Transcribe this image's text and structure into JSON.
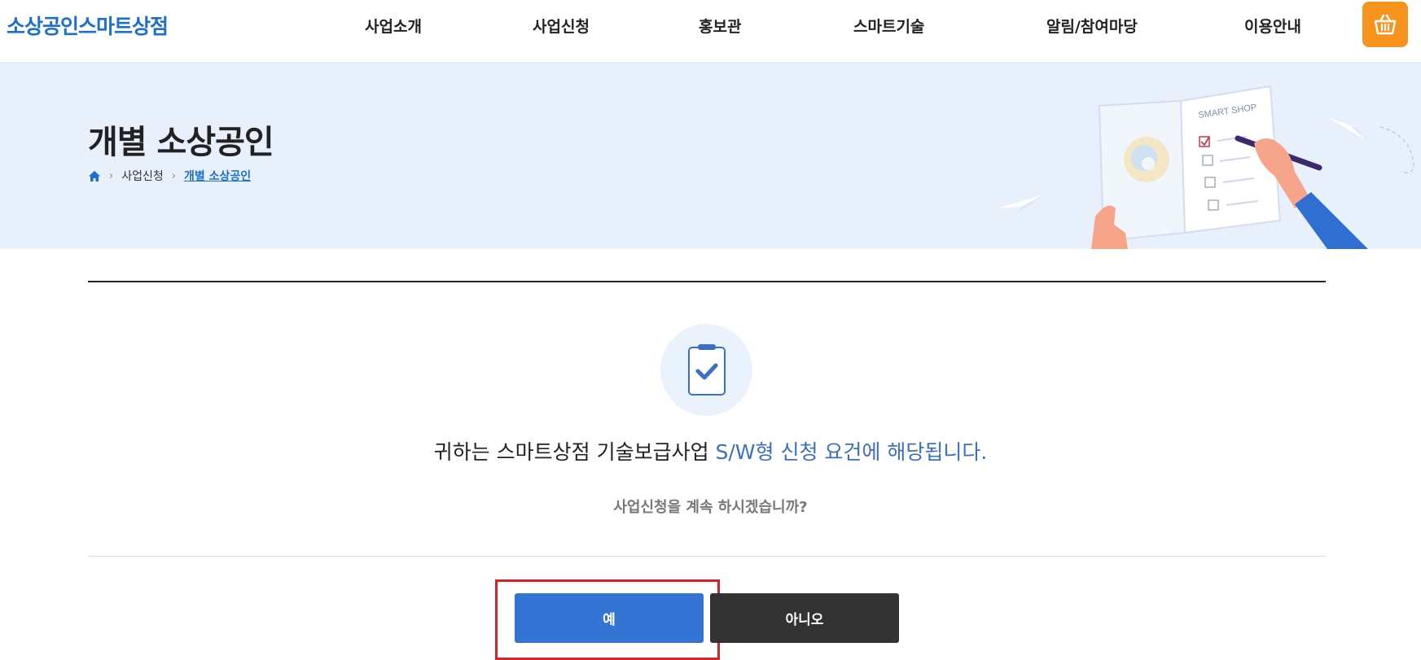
{
  "header": {
    "logo": "소상공인스마트상점",
    "nav": [
      {
        "label": "사업소개"
      },
      {
        "label": "사업신청"
      },
      {
        "label": "홍보관"
      },
      {
        "label": "스마트기술"
      },
      {
        "label": "알림/참여마당"
      },
      {
        "label": "이용안내"
      }
    ],
    "cart_icon": "basket-icon"
  },
  "banner": {
    "title": "개별 소상공인",
    "breadcrumb": {
      "home_icon": "home-icon",
      "items": [
        "사업신청",
        "개별 소상공인"
      ]
    },
    "illustration_text": "SMART SHOP"
  },
  "content": {
    "icon": "clipboard-check-icon",
    "headline_prefix": "귀하는 스마트상점 기술보급사업 ",
    "headline_highlight": "S/W형 신청 요건에 해당됩니다.",
    "question": "사업신청을 계속 하시겠습니까?",
    "buttons": {
      "yes": "예",
      "no": "아니오"
    }
  },
  "colors": {
    "brand": "#1a6fd0",
    "cart": "#f7941d",
    "banner_bg": "#e8f0fc",
    "primary_button": "#3474d4",
    "secondary_button": "#333333",
    "highlight": "#d0242a"
  }
}
